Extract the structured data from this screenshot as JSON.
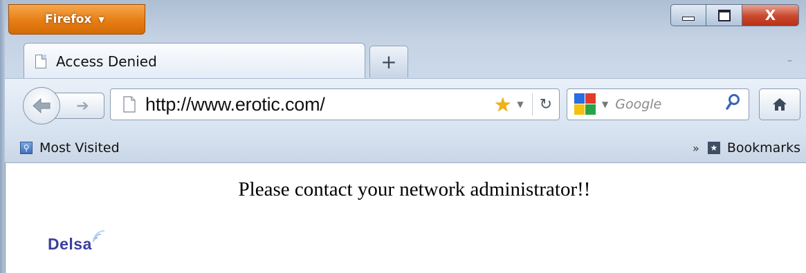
{
  "browser": {
    "app_button_label": "Firefox",
    "window_controls": {
      "close_glyph": "X"
    }
  },
  "tabs": [
    {
      "label": "Access Denied"
    }
  ],
  "new_tab_glyph": "+",
  "navbar": {
    "url": "http://www.erotic.com/",
    "search_placeholder": "Google"
  },
  "bookmarks_bar": {
    "left_item": "Most Visited",
    "right_item": "Bookmarks",
    "overflow_glyph": "»"
  },
  "page": {
    "message": "Please contact your network administrator!!",
    "logo_text": "Delsa"
  },
  "colors": {
    "firefox_orange": "#e67e14",
    "close_red": "#c9482e",
    "logo_blue": "#3b3f9c",
    "google_blue": "#2a6de0"
  }
}
